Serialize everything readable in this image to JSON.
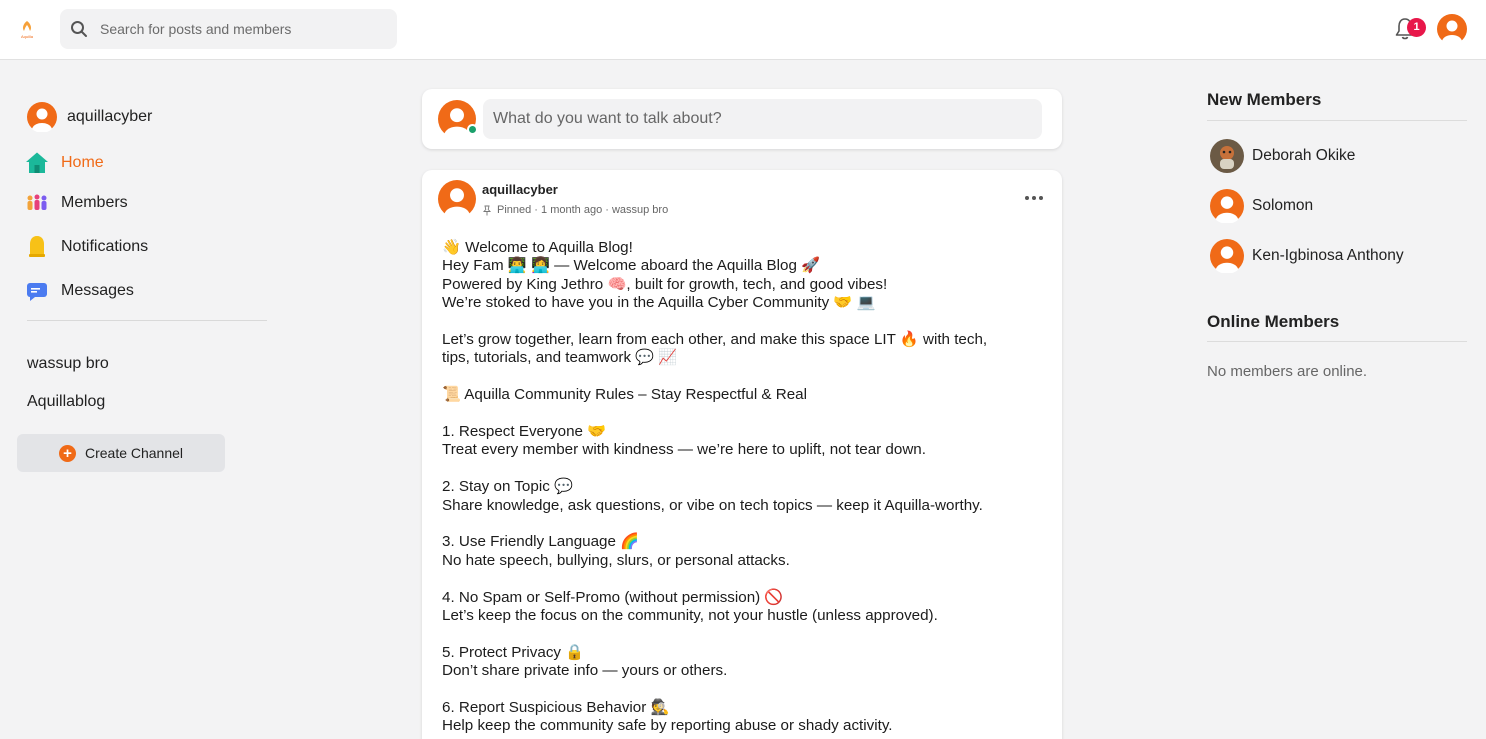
{
  "header": {
    "logo_text": "Aquilla",
    "search_placeholder": "Search for posts and members",
    "notification_count": "1"
  },
  "sidebar": {
    "username": "aquillacyber",
    "nav": [
      {
        "label": "Home",
        "icon": "home-icon",
        "active": true
      },
      {
        "label": "Members",
        "icon": "members-icon"
      },
      {
        "label": "Notifications",
        "icon": "bell-icon"
      },
      {
        "label": "Messages",
        "icon": "messages-icon"
      }
    ],
    "channels": [
      "wassup bro",
      "Aquillablog"
    ],
    "create_channel_label": "Create Channel"
  },
  "composer": {
    "placeholder": "What do you want to talk about?"
  },
  "post": {
    "author": "aquillacyber",
    "meta": "Pinned · 1 month ago · wassup bro",
    "lines": [
      "👋 Welcome to Aquilla Blog!",
      "Hey Fam 👨‍💻 👩‍💻 — Welcome aboard the Aquilla Blog 🚀",
      "Powered by King Jethro 🧠, built for growth, tech, and good vibes!",
      "We’re stoked to have you in the Aquilla Cyber Community 🤝 💻",
      "",
      "Let’s grow together, learn from each other, and make this space LIT 🔥 with tech,",
      "tips, tutorials, and teamwork 💬 📈",
      "",
      "📜 Aquilla Community Rules – Stay Respectful & Real",
      "",
      "1. Respect Everyone 🤝",
      "Treat every member with kindness — we’re here to uplift, not tear down.",
      "",
      "2. Stay on Topic 💬",
      "Share knowledge, ask questions, or vibe on tech topics — keep it Aquilla-worthy.",
      "",
      "3. Use Friendly Language 🌈",
      "No hate speech, bullying, slurs, or personal attacks.",
      "",
      "4. No Spam or Self-Promo (without permission) 🚫",
      "Let’s keep the focus on the community, not your hustle (unless approved).",
      "",
      "5. Protect Privacy 🔒",
      "Don’t share private info — yours or others.",
      "",
      "6. Report Suspicious Behavior 🕵️",
      "Help keep the community safe by reporting abuse or shady activity."
    ]
  },
  "right": {
    "new_members_title": "New Members",
    "new_members": [
      "Deborah Okike",
      "Solomon",
      "Ken-Igbinosa Anthony"
    ],
    "online_title": "Online Members",
    "online_empty": "No members are online."
  },
  "colors": {
    "accent": "#f06a17",
    "badge": "#e8174a",
    "online": "#1aa06b",
    "background": "#f3f3f4"
  }
}
